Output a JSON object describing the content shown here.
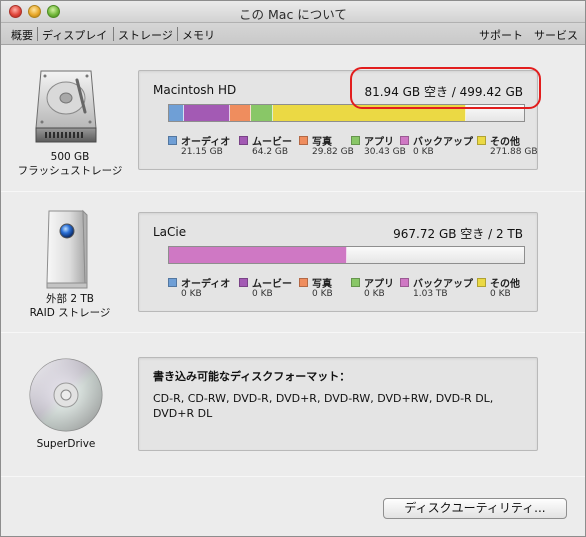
{
  "window": {
    "title": "この Mac について"
  },
  "toolbar": {
    "tabs": [
      "概要",
      "ディスプレイ",
      "ストレージ",
      "メモリ"
    ],
    "links": [
      "サポート",
      "サービス"
    ]
  },
  "legend_labels": [
    "オーディオ",
    "ムービー",
    "写真",
    "アプリ",
    "バックアップ",
    "その他"
  ],
  "colors": {
    "audio": "#6f9fd6",
    "movie": "#a35ab4",
    "photo": "#ef8d5e",
    "apps": "#89c767",
    "backup": "#cf78c4",
    "other": "#ebd944",
    "highlight": "#e21d1d"
  },
  "devices": [
    {
      "icon": "hard-drive-icon",
      "label_line1": "500 GB",
      "label_line2": "フラッシュストレージ",
      "name": "Macintosh HD",
      "free": "81.94 GB 空き / 499.42 GB",
      "usage_fractions": [
        0.042,
        0.129,
        0.06,
        0.061,
        0,
        0.545
      ],
      "values": [
        "21.15 GB",
        "64.2 GB",
        "29.82 GB",
        "30.43 GB",
        "0 KB",
        "271.88 GB"
      ]
    },
    {
      "icon": "external-drive-icon",
      "label_line1": "外部 2 TB",
      "label_line2": "RAID ストレージ",
      "name": "LaCie",
      "free": "967.72 GB 空き / 2 TB",
      "usage_fractions": [
        0,
        0,
        0,
        0,
        0.5,
        0
      ],
      "values": [
        "0 KB",
        "0 KB",
        "0 KB",
        "0 KB",
        "1.03 TB",
        "0 KB"
      ]
    }
  ],
  "superdrive": {
    "icon": "optical-disc-icon",
    "label": "SuperDrive",
    "title": "書き込み可能なディスクフォーマット：",
    "formats": "CD-R, CD-RW, DVD-R, DVD+R, DVD-RW, DVD+RW, DVD-R DL, DVD+R DL"
  },
  "button": {
    "disk_utility": "ディスクユーティリティ..."
  }
}
